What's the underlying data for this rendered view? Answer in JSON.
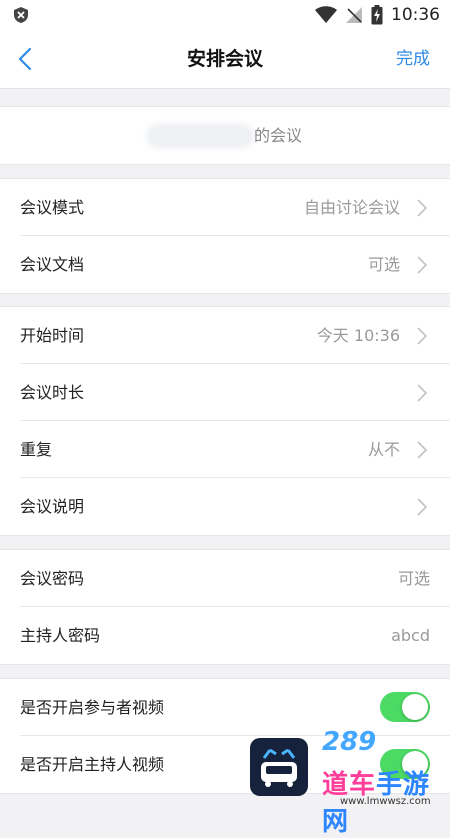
{
  "status_bar": {
    "time": "10:36",
    "icons": [
      "shield-icon",
      "wifi-icon",
      "no-signal-icon",
      "battery-icon"
    ]
  },
  "nav": {
    "back_icon": "chevron-left-icon",
    "title": "安排会议",
    "done_label": "完成"
  },
  "topic": {
    "suffix": "的会议"
  },
  "group1": [
    {
      "label": "会议模式",
      "value": "自由讨论会议"
    },
    {
      "label": "会议文档",
      "value": "可选"
    }
  ],
  "group2": [
    {
      "label": "开始时间",
      "value": "今天 10:36"
    },
    {
      "label": "会议时长",
      "value": ""
    },
    {
      "label": "重复",
      "value": "从不"
    },
    {
      "label": "会议说明",
      "value": ""
    }
  ],
  "group3": [
    {
      "label": "会议密码",
      "value": "可选"
    },
    {
      "label": "主持人密码",
      "value": "abcd"
    }
  ],
  "group4": [
    {
      "label": "是否开启参与者视频",
      "on": true
    },
    {
      "label": "是否开启主持人视频",
      "on": true
    }
  ],
  "watermark": {
    "sub": "289",
    "brand_a": "道车",
    "brand_b": "手游网",
    "url": "www.lmwwsz.com"
  },
  "colors": {
    "accent": "#2f8ae5",
    "toggle_on": "#4cd964",
    "background": "#f2f2f4"
  }
}
